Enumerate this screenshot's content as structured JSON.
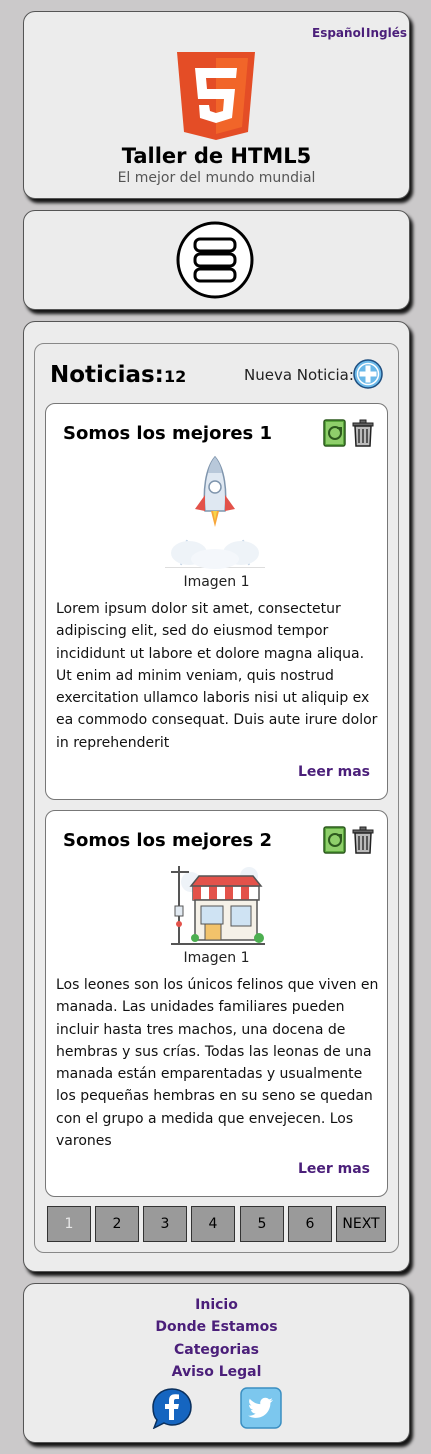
{
  "header": {
    "lang_es": "Español",
    "lang_en": "Inglés",
    "logo_icon": "html5-logo-icon",
    "title": "Taller de HTML5",
    "subtitle": "El mejor del mundo mundial"
  },
  "menu": {
    "icon": "hamburger-menu-icon"
  },
  "news": {
    "title": "Noticias:",
    "count": "12",
    "new_label": "Nueva Noticia:",
    "add_icon": "add-plus-icon",
    "items": [
      {
        "title": "Somos los mejores 1",
        "image_icon": "rocket-illustration",
        "caption": "Imagen 1",
        "text": "Lorem ipsum dolor sit amet, consectetur adipiscing elit, sed do eiusmod tempor incididunt ut labore et dolore magna aliqua. Ut enim ad minim veniam, quis nostrud exercitation ullamco laboris nisi ut aliquip ex ea commodo consequat. Duis aute irure dolor in reprehenderit",
        "read_more": "Leer mas"
      },
      {
        "title": "Somos los mejores 2",
        "image_icon": "shop-illustration",
        "caption": "Imagen 1",
        "text": "Los leones son los únicos felinos que viven en manada. Las unidades familiares pueden incluir hasta tres machos, una docena de hembras y sus crías. Todas las leonas de una manada están emparentadas y usualmente los pequeñas hembras en su seno se quedan con el grupo a medida que envejecen. Los varones",
        "read_more": "Leer mas"
      }
    ],
    "pages": [
      "1",
      "2",
      "3",
      "4",
      "5",
      "6",
      "NEXT"
    ],
    "active_page": "1"
  },
  "footer": {
    "links": [
      "Inicio",
      "Donde Estamos",
      "Categorias",
      "Aviso Legal"
    ],
    "social": [
      "facebook-icon",
      "twitter-icon"
    ]
  },
  "colors": {
    "background": "#cbc9ca",
    "panel": "#ececec",
    "link": "#4b1f7a",
    "html5_orange": "#e44d26",
    "pager_button": "#9a9a9a"
  }
}
